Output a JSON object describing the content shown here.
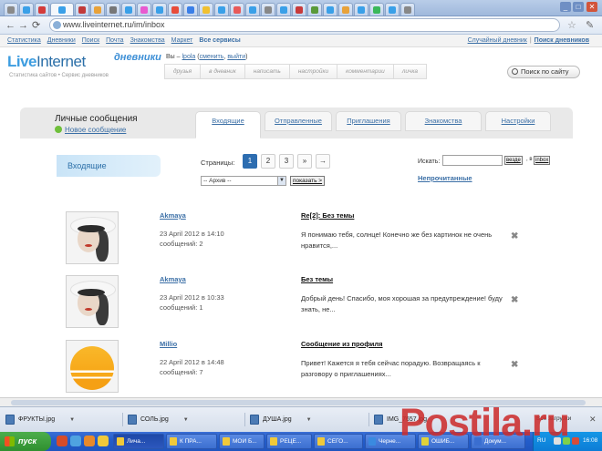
{
  "browser": {
    "url": "www.liveinternet.ru/im/inbox"
  },
  "top_nav": {
    "links": [
      "Статистика",
      "Дневники",
      "Поиск",
      "Почта",
      "Знакомства",
      "Маркет"
    ],
    "all_services": "Все сервисы",
    "random_diary": "Случайный дневник",
    "separator": "|",
    "diary_search": "Поиск дневников"
  },
  "header": {
    "logo_live": "Live",
    "logo_internet": "Internet",
    "logo_sub": "Статистика сайтов • Сервис дневников",
    "dnevniki": "дневники",
    "you_are": "Вы –",
    "user": "lpola",
    "change": "сменить",
    "sep": ",",
    "logout": "выйти",
    "site_search": "Поиск по сайту"
  },
  "nav_tabs": [
    "друзья",
    "в дневник",
    "написать",
    "настройки",
    "комментарии",
    "личка"
  ],
  "messages_page": {
    "title": "Личные сообщения",
    "new_message": "Новое сообщение",
    "tabs": [
      "Входящие",
      "Отправленные",
      "Приглашения",
      "Знакомства",
      "Настройки"
    ],
    "sidebar_inbox": "Входящие",
    "pages_label": "Страницы:",
    "pages": [
      "1",
      "2",
      "3",
      "»",
      "→"
    ],
    "current_page": "1",
    "archive_select": "-- Архив --",
    "show_button": "показать >",
    "search_label": "Искать:",
    "search_everywhere": "везде",
    "in_label": ", в",
    "inbox_button": "inbox",
    "unread_link": "Непрочитанные"
  },
  "messages": [
    {
      "sender": "Akmaya",
      "date": "23 April 2012 в 14:10",
      "count": "сообщений: 2",
      "subject": "Re[2]: Без темы",
      "preview": "Я понимаю тебя, солнце! Конечно же без картинок не очень нравится,..."
    },
    {
      "sender": "Akmaya",
      "date": "23 April 2012 в 10:33",
      "count": "сообщений: 1",
      "subject": "Без темы",
      "preview": "Добрый день! Спасибо, моя хорошая за предупреждение! буду знать, не..."
    },
    {
      "sender": "Millio",
      "date": "22 April 2012 в 14:48",
      "count": "сообщений: 7",
      "subject": "Сообщение из профиля",
      "preview": "Привет! Кажется я тебя сейчас порадую. Возвращаясь к разговору о приглашениях..."
    }
  ],
  "downloads": {
    "items": [
      "ФРУКТЫ.jpg",
      "СОЛЬ.jpg",
      "ДУША.jpg",
      "IMG_7657.jpg"
    ],
    "show_all": "Все загрузки"
  },
  "taskbar": {
    "start": "пуск",
    "windows": [
      "Лича...",
      "К ПРА...",
      "МОИ Б...",
      "РЕЦЕ...",
      "СЕГО...",
      "Черне...",
      "ОШИБ...",
      "Докум..."
    ],
    "lang": "RU",
    "time": "16:08"
  },
  "watermark": "Postila.ru",
  "colors": {
    "link": "#3b6fa6",
    "page_current": "#2d6db0",
    "taskbar": "#245ecb",
    "start": "#3f9f3f"
  }
}
